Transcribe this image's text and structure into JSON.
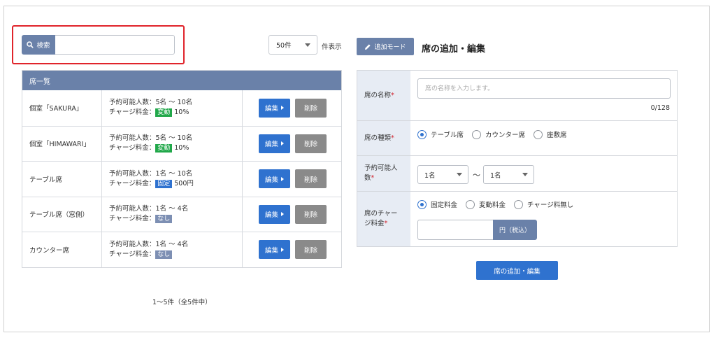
{
  "search": {
    "button_label": "検索",
    "value": "",
    "placeholder": ""
  },
  "page_size": {
    "selected": "50件",
    "suffix": "件表示"
  },
  "list": {
    "header": "席一覧",
    "rows": [
      {
        "name": "個室「SAKURA」",
        "capacity": "予約可能人数：5名 ～ 10名",
        "charge_label": "チャージ料金：",
        "charge_badge": "変動",
        "charge_value": "10%",
        "edit_label": "編集",
        "delete_label": "削除"
      },
      {
        "name": "個室「HIMAWARI」",
        "capacity": "予約可能人数：5名 ～ 10名",
        "charge_label": "チャージ料金：",
        "charge_badge": "変動",
        "charge_value": "10%",
        "edit_label": "編集",
        "delete_label": "削除"
      },
      {
        "name": "テーブル席",
        "capacity": "予約可能人数：1名 ～ 10名",
        "charge_label": "チャージ料金：",
        "charge_badge": "固定",
        "charge_value": "500円",
        "edit_label": "編集",
        "delete_label": "削除"
      },
      {
        "name": "テーブル席（窓側）",
        "capacity": "予約可能人数：1名 ～ 4名",
        "charge_label": "チャージ料金：",
        "charge_badge": "なし",
        "charge_value": "",
        "edit_label": "編集",
        "delete_label": "削除"
      },
      {
        "name": "カウンター席",
        "capacity": "予約可能人数：1名 ～ 4名",
        "charge_label": "チャージ料金：",
        "charge_badge": "なし",
        "charge_value": "",
        "edit_label": "編集",
        "delete_label": "削除"
      }
    ]
  },
  "pagination": {
    "text": "1～5件（全5件中）"
  },
  "form": {
    "mode_badge": "追加モード",
    "title": "席の追加・編集",
    "name_field": {
      "label": "席の名称",
      "required_mark": "*",
      "value": "",
      "placeholder": "席の名称を入力します。",
      "counter": "0/128"
    },
    "type_field": {
      "label": "席の種類",
      "required_mark": "*",
      "options": [
        "テーブル席",
        "カウンター席",
        "座敷席"
      ],
      "selected": "テーブル席"
    },
    "capacity_field": {
      "label_line1": "予約可能人",
      "label_line2": "数",
      "required_mark": "*",
      "min_selected": "1名",
      "separator": "～",
      "max_selected": "1名"
    },
    "charge_field": {
      "label_line1": "席のチャー",
      "label_line2": "ジ料金",
      "required_mark": "*",
      "options": [
        "固定料金",
        "変動料金",
        "チャージ料無し"
      ],
      "selected": "固定料金",
      "amount_value": "",
      "unit_label": "円（税込）"
    },
    "submit_label": "席の追加・編集"
  },
  "colors": {
    "header_blue_gray": "#6a81a9",
    "primary_button": "#2f72cf",
    "delete_button": "#8a8a8a",
    "badge_variable": "#21a84a",
    "badge_fixed": "#2f72cf",
    "badge_none": "#7d8fb3",
    "required": "#d0202a",
    "highlight_outline": "#e0242b"
  }
}
